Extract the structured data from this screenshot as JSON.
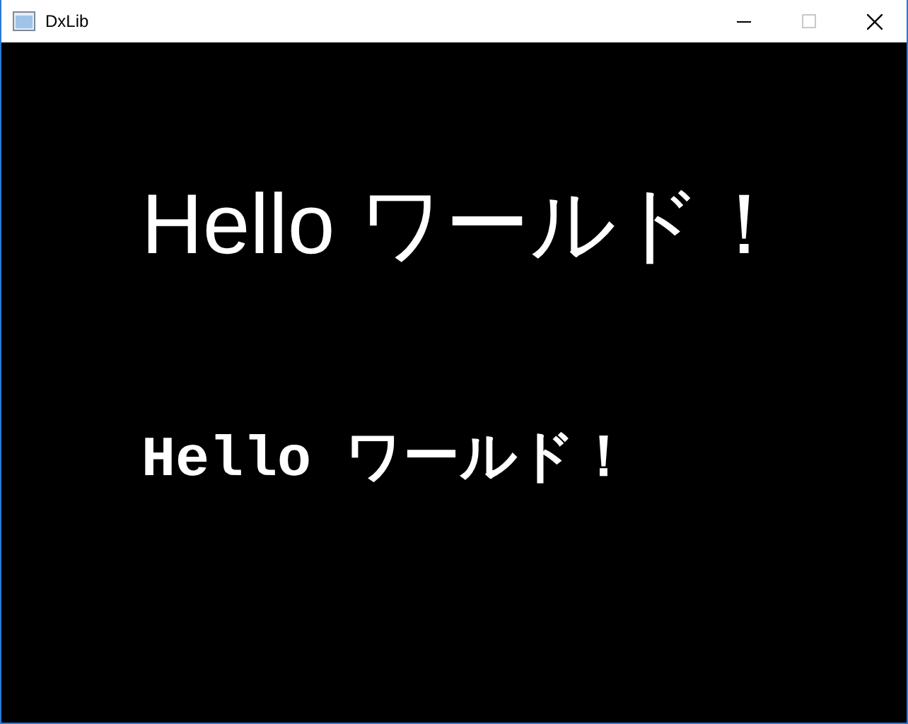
{
  "window": {
    "title": "DxLib"
  },
  "texts": [
    {
      "kind": "large",
      "text": "Hello ワールド！"
    },
    {
      "kind": "mono",
      "text": "Hello ワールド！"
    }
  ]
}
